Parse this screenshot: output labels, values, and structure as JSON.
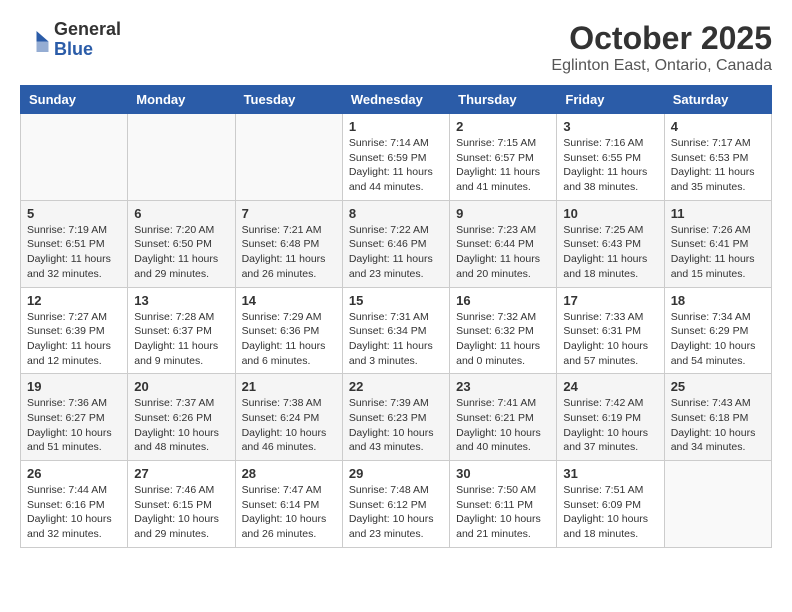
{
  "header": {
    "logo_general": "General",
    "logo_blue": "Blue",
    "month_title": "October 2025",
    "location": "Eglinton East, Ontario, Canada"
  },
  "weekdays": [
    "Sunday",
    "Monday",
    "Tuesday",
    "Wednesday",
    "Thursday",
    "Friday",
    "Saturday"
  ],
  "weeks": [
    [
      {
        "day": "",
        "info": ""
      },
      {
        "day": "",
        "info": ""
      },
      {
        "day": "",
        "info": ""
      },
      {
        "day": "1",
        "info": "Sunrise: 7:14 AM\nSunset: 6:59 PM\nDaylight: 11 hours\nand 44 minutes."
      },
      {
        "day": "2",
        "info": "Sunrise: 7:15 AM\nSunset: 6:57 PM\nDaylight: 11 hours\nand 41 minutes."
      },
      {
        "day": "3",
        "info": "Sunrise: 7:16 AM\nSunset: 6:55 PM\nDaylight: 11 hours\nand 38 minutes."
      },
      {
        "day": "4",
        "info": "Sunrise: 7:17 AM\nSunset: 6:53 PM\nDaylight: 11 hours\nand 35 minutes."
      }
    ],
    [
      {
        "day": "5",
        "info": "Sunrise: 7:19 AM\nSunset: 6:51 PM\nDaylight: 11 hours\nand 32 minutes."
      },
      {
        "day": "6",
        "info": "Sunrise: 7:20 AM\nSunset: 6:50 PM\nDaylight: 11 hours\nand 29 minutes."
      },
      {
        "day": "7",
        "info": "Sunrise: 7:21 AM\nSunset: 6:48 PM\nDaylight: 11 hours\nand 26 minutes."
      },
      {
        "day": "8",
        "info": "Sunrise: 7:22 AM\nSunset: 6:46 PM\nDaylight: 11 hours\nand 23 minutes."
      },
      {
        "day": "9",
        "info": "Sunrise: 7:23 AM\nSunset: 6:44 PM\nDaylight: 11 hours\nand 20 minutes."
      },
      {
        "day": "10",
        "info": "Sunrise: 7:25 AM\nSunset: 6:43 PM\nDaylight: 11 hours\nand 18 minutes."
      },
      {
        "day": "11",
        "info": "Sunrise: 7:26 AM\nSunset: 6:41 PM\nDaylight: 11 hours\nand 15 minutes."
      }
    ],
    [
      {
        "day": "12",
        "info": "Sunrise: 7:27 AM\nSunset: 6:39 PM\nDaylight: 11 hours\nand 12 minutes."
      },
      {
        "day": "13",
        "info": "Sunrise: 7:28 AM\nSunset: 6:37 PM\nDaylight: 11 hours\nand 9 minutes."
      },
      {
        "day": "14",
        "info": "Sunrise: 7:29 AM\nSunset: 6:36 PM\nDaylight: 11 hours\nand 6 minutes."
      },
      {
        "day": "15",
        "info": "Sunrise: 7:31 AM\nSunset: 6:34 PM\nDaylight: 11 hours\nand 3 minutes."
      },
      {
        "day": "16",
        "info": "Sunrise: 7:32 AM\nSunset: 6:32 PM\nDaylight: 11 hours\nand 0 minutes."
      },
      {
        "day": "17",
        "info": "Sunrise: 7:33 AM\nSunset: 6:31 PM\nDaylight: 10 hours\nand 57 minutes."
      },
      {
        "day": "18",
        "info": "Sunrise: 7:34 AM\nSunset: 6:29 PM\nDaylight: 10 hours\nand 54 minutes."
      }
    ],
    [
      {
        "day": "19",
        "info": "Sunrise: 7:36 AM\nSunset: 6:27 PM\nDaylight: 10 hours\nand 51 minutes."
      },
      {
        "day": "20",
        "info": "Sunrise: 7:37 AM\nSunset: 6:26 PM\nDaylight: 10 hours\nand 48 minutes."
      },
      {
        "day": "21",
        "info": "Sunrise: 7:38 AM\nSunset: 6:24 PM\nDaylight: 10 hours\nand 46 minutes."
      },
      {
        "day": "22",
        "info": "Sunrise: 7:39 AM\nSunset: 6:23 PM\nDaylight: 10 hours\nand 43 minutes."
      },
      {
        "day": "23",
        "info": "Sunrise: 7:41 AM\nSunset: 6:21 PM\nDaylight: 10 hours\nand 40 minutes."
      },
      {
        "day": "24",
        "info": "Sunrise: 7:42 AM\nSunset: 6:19 PM\nDaylight: 10 hours\nand 37 minutes."
      },
      {
        "day": "25",
        "info": "Sunrise: 7:43 AM\nSunset: 6:18 PM\nDaylight: 10 hours\nand 34 minutes."
      }
    ],
    [
      {
        "day": "26",
        "info": "Sunrise: 7:44 AM\nSunset: 6:16 PM\nDaylight: 10 hours\nand 32 minutes."
      },
      {
        "day": "27",
        "info": "Sunrise: 7:46 AM\nSunset: 6:15 PM\nDaylight: 10 hours\nand 29 minutes."
      },
      {
        "day": "28",
        "info": "Sunrise: 7:47 AM\nSunset: 6:14 PM\nDaylight: 10 hours\nand 26 minutes."
      },
      {
        "day": "29",
        "info": "Sunrise: 7:48 AM\nSunset: 6:12 PM\nDaylight: 10 hours\nand 23 minutes."
      },
      {
        "day": "30",
        "info": "Sunrise: 7:50 AM\nSunset: 6:11 PM\nDaylight: 10 hours\nand 21 minutes."
      },
      {
        "day": "31",
        "info": "Sunrise: 7:51 AM\nSunset: 6:09 PM\nDaylight: 10 hours\nand 18 minutes."
      },
      {
        "day": "",
        "info": ""
      }
    ]
  ]
}
